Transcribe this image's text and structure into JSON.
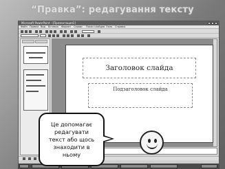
{
  "slide": {
    "title": "“Правка”: редагування тексту"
  },
  "window": {
    "title": "Microsoft PowerPoint - [Презентация1]",
    "menu": [
      "Файл",
      "Правка",
      "Вид",
      "Вставка",
      "Формат",
      "Сервис",
      "Показ слайдов",
      "Окно",
      "Справка"
    ]
  },
  "editor": {
    "title_placeholder": "Заголовок слайда",
    "subtitle_placeholder": "Подзаголовок слайда"
  },
  "callout": {
    "text": "Це допомагає\nредагувати\nтекст або щось\nзнаходити в\nньому"
  }
}
